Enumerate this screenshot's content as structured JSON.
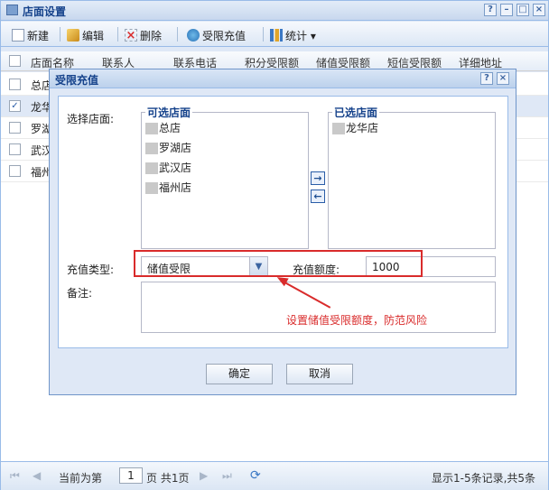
{
  "window": {
    "title": "店面设置",
    "controls": [
      "?",
      "–",
      "□",
      "×"
    ]
  },
  "toolbar": {
    "new_label": "新建",
    "edit_label": "编辑",
    "delete_label": "删除",
    "limit_recharge_label": "受限充值",
    "stats_label": "统计 ▾"
  },
  "grid": {
    "columns": [
      "店面名称",
      "联系人",
      "联系电话",
      "积分受限额",
      "储值受限额",
      "短信受限额",
      "详细地址"
    ],
    "rows": [
      {
        "name": "总店",
        "checked": false
      },
      {
        "name": "龙华",
        "checked": true
      },
      {
        "name": "罗湖",
        "checked": false
      },
      {
        "name": "武汉",
        "checked": false
      },
      {
        "name": "福州",
        "checked": false
      }
    ]
  },
  "pager": {
    "prefix": "当前为第",
    "page": "1",
    "suffix": "页 共1页",
    "summary": "显示1-5条记录,共5条"
  },
  "dialog": {
    "title": "受限充值",
    "help": "?",
    "close": "×",
    "select_store_label": "选择店面:",
    "available_legend": "可选店面",
    "available_items": [
      "总店",
      "罗湖店",
      "武汉店",
      "福州店"
    ],
    "selected_legend": "已选店面",
    "selected_items": [
      "龙华店"
    ],
    "move_right": "→",
    "move_left": "←",
    "recharge_type_label": "充值类型:",
    "recharge_type_value": "储值受限",
    "amount_label": "充值额度:",
    "amount_value": "1000",
    "note_label": "备注:",
    "annotation": "设置储值受限额度，防范风险",
    "ok_label": "确定",
    "cancel_label": "取消"
  },
  "colors": {
    "accent": "#15428b",
    "border": "#99bbe8",
    "highlight": "#d92b2b"
  }
}
